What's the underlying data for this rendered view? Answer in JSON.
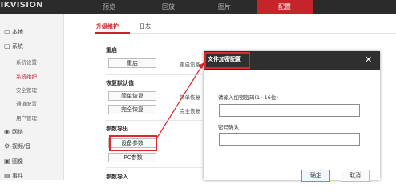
{
  "header": {
    "logo": "HIKVISION",
    "nav": [
      "预览",
      "回放",
      "图片",
      "配置"
    ],
    "active_nav": "配置"
  },
  "sidebar": {
    "groups": [
      {
        "label": "本地",
        "icon": "monitor-icon"
      },
      {
        "label": "系统",
        "icon": "system-icon"
      }
    ],
    "system_items": [
      "系统设置",
      "系统维护",
      "安全管理",
      "通道配置",
      "用户管理"
    ],
    "active_item": "系统维护",
    "more_groups": [
      {
        "label": "网络",
        "icon": "globe-icon"
      },
      {
        "label": "视频/音",
        "icon": "video-icon"
      },
      {
        "label": "图像",
        "icon": "image-icon"
      },
      {
        "label": "事件",
        "icon": "event-icon"
      }
    ]
  },
  "tabs": [
    "升级维护",
    "日志"
  ],
  "active_tab": "升级维护",
  "sections": {
    "reboot": {
      "title": "重启",
      "button": "重启",
      "hint": "重启设备"
    },
    "restore": {
      "title": "恢复默认值",
      "simple_button": "简单恢复",
      "simple_hint": "简单恢复",
      "full_button": "完全恢复",
      "full_hint": "完全恢复"
    },
    "export": {
      "title": "参数导出",
      "device_button": "设备参数",
      "ipc_button": "IPC参数"
    },
    "import": {
      "title": "参数导入"
    }
  },
  "modal": {
    "title": "文件加密配置",
    "password_label": "请输入加密密码(1~16位)",
    "password_value": "",
    "confirm_label": "密码确认",
    "confirm_value": "",
    "ok_button": "确定",
    "cancel_button": "取消",
    "close": "✕"
  },
  "colors": {
    "brand_red": "#c4242a",
    "highlight_red": "#e0262c",
    "header_bg": "#2b2b2b",
    "modal_header_bg": "#2f2f2f"
  }
}
